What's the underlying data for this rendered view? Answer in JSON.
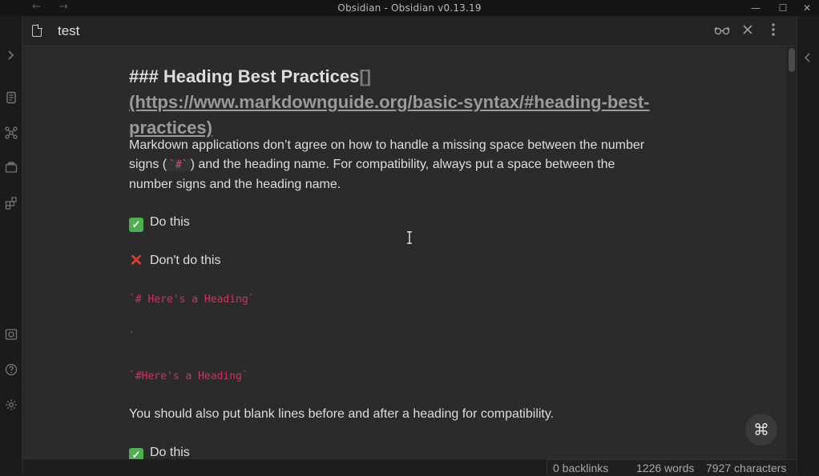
{
  "window": {
    "title": "Obsidian - Obsidian v0.13.19",
    "back_glyph": "←",
    "forward_glyph": "→",
    "minimize_glyph": "—",
    "maximize_glyph": "☐",
    "close_glyph": "✕"
  },
  "ribbon": {
    "icons": [
      "collapse-chevron-icon",
      "quick-switcher-icon",
      "graph-view-icon",
      "templates-icon",
      "canvas-blocks-icon",
      "vault-icon",
      "help-icon",
      "settings-icon"
    ]
  },
  "tab": {
    "title": "test",
    "reading_view_icon": "glasses-icon",
    "close_icon": "close-icon",
    "more_icon": "more-vertical-icon"
  },
  "document": {
    "heading": {
      "prefix": "### Heading Best Practices",
      "brackets": "[]",
      "link_text": "(https://www.markdownguide.org/basic-syntax/#heading-best-practices)"
    },
    "para1": {
      "before_code": "Markdown applications don’t agree on how to handle a missing space between the number signs (",
      "code": "`#`",
      "after_code": ") and the heading name. For compatibility, always put a space between the number signs and the heading name."
    },
    "do_this_1": "Do this",
    "dont_do_this": "Don't do this",
    "code_1": "`# Here's a Heading`",
    "code_2": "`",
    "code_3": "`#Here's a Heading`",
    "para2": "You should also put blank lines before and after a heading for compatibility.",
    "do_this_2": "Do this"
  },
  "command_button": {
    "glyph": "⌘"
  },
  "status": {
    "backlinks": "0 backlinks",
    "words": "1226 words",
    "characters": "7927 characters"
  },
  "colors": {
    "background": "#2b2b2b",
    "inline_code": "#d2335c",
    "check_green": "#4caf50",
    "cross_red": "#e53935"
  }
}
